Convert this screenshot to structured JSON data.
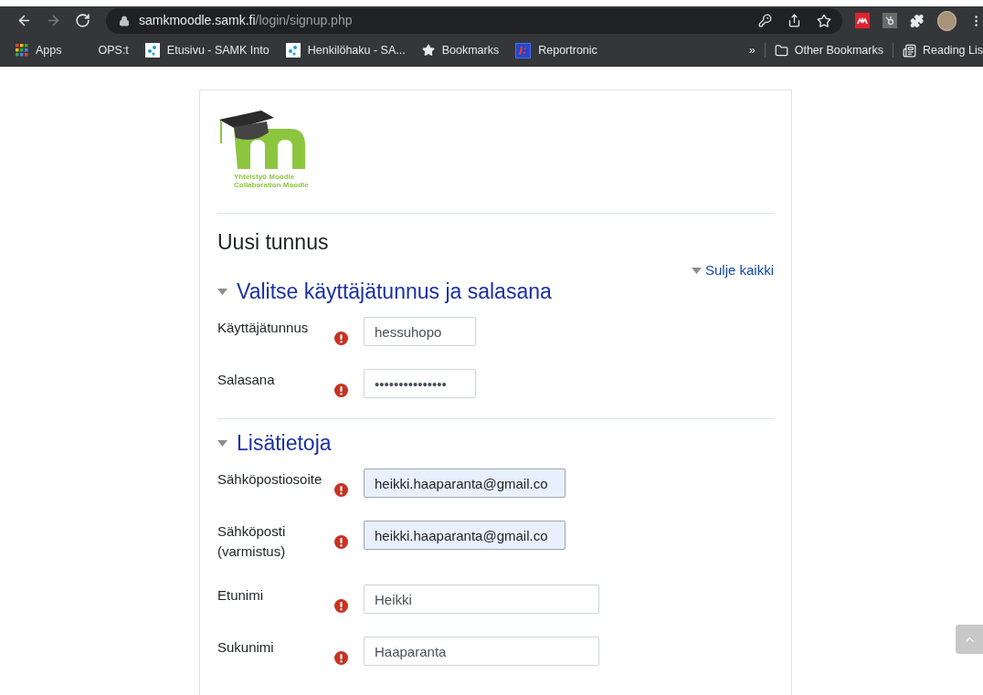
{
  "browser": {
    "nav": [
      {
        "kind": "back",
        "disabled": false
      },
      {
        "kind": "forward",
        "disabled": true
      },
      {
        "kind": "reload",
        "disabled": false
      }
    ],
    "url": {
      "host": "samkmoodle.samk.fi",
      "path": "/login/signup.php"
    },
    "toolbar_icons": [
      {
        "kind": "key"
      },
      {
        "kind": "share"
      },
      {
        "kind": "star"
      },
      {
        "kind": "ext-red"
      },
      {
        "kind": "ext-gray"
      },
      {
        "kind": "puzzle"
      },
      {
        "kind": "avatar"
      },
      {
        "kind": "menu"
      }
    ],
    "bookmarks": [
      {
        "label": "Apps",
        "kind": "apps"
      },
      {
        "label": "OPS:t",
        "kind": "plain"
      },
      {
        "label": "Etusivu - SAMK Into",
        "kind": "site"
      },
      {
        "label": "Henkilöhaku - SA...",
        "kind": "site"
      },
      {
        "label": "Bookmarks",
        "kind": "star"
      },
      {
        "label": "Reportronic",
        "kind": "reportronic"
      }
    ],
    "overflow": "»",
    "other_bookmarks": "Other Bookmarks",
    "reading_list": "Reading Lis"
  },
  "page": {
    "logo": {
      "line1": "Yhteistyö Moodle",
      "line2": "Collaboration Moodle"
    },
    "title": "Uusi tunnus",
    "collapse_link": "Sulje kaikki",
    "sections": [
      {
        "title": "Valitse käyttäjätunnus ja salasana",
        "expanded": true,
        "fields": [
          {
            "label": "Käyttäjätunnus",
            "value": "hessuhopo",
            "kind": "username",
            "required": true,
            "autofilled": false
          },
          {
            "label": "Salasana",
            "value": "•••••••••••••••",
            "kind": "password",
            "required": true,
            "autofilled": false
          }
        ]
      },
      {
        "title": "Lisätietoja",
        "expanded": true,
        "fields": [
          {
            "label": "Sähköpostiosoite",
            "value": "heikki.haaparanta@gmail.co",
            "kind": "email",
            "required": true,
            "autofilled": true
          },
          {
            "label": "Sähköposti (varmistus)",
            "value": "heikki.haaparanta@gmail.co",
            "kind": "email",
            "required": true,
            "autofilled": true
          },
          {
            "label": "Etunimi",
            "value": "Heikki",
            "kind": "text",
            "required": true,
            "autofilled": false
          },
          {
            "label": "Sukunimi",
            "value": "Haaparanta",
            "kind": "text",
            "required": true,
            "autofilled": false
          }
        ]
      }
    ]
  }
}
